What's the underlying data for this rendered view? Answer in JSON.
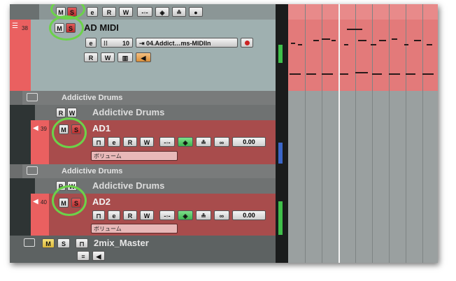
{
  "tracks": {
    "top_partial": {
      "buttons": [
        "M",
        "S",
        "e",
        "R",
        "W"
      ]
    },
    "ad_midi": {
      "number": "38",
      "name": "AD MIDI",
      "mute": "M",
      "solo": "S",
      "edit": "e",
      "channel": "10",
      "output": "04.Addict…ms-MIDIIn",
      "read": "R",
      "write": "W"
    },
    "folder1": {
      "name": "Addictive Drums"
    },
    "group1": {
      "name": "Addictive Drums",
      "read": "R",
      "write": "W"
    },
    "ad1": {
      "number": "39",
      "name": "AD1",
      "mute": "M",
      "solo": "S",
      "edit": "e",
      "read": "R",
      "write": "W",
      "link": "∞",
      "value": "0.00",
      "automation": "ボリューム"
    },
    "folder2": {
      "name": "Addictive Drums"
    },
    "group2": {
      "name": "Addictive Drums",
      "read": "R",
      "write": "W"
    },
    "ad2": {
      "number": "40",
      "name": "AD2",
      "mute": "M",
      "solo": "S",
      "edit": "e",
      "read": "R",
      "write": "W",
      "link": "∞",
      "value": "0.00",
      "automation": "ボリューム"
    },
    "master": {
      "name": "2mix_Master",
      "mute": "M",
      "solo": "S"
    }
  },
  "colors": {
    "midi_track": "#9fb0b0",
    "audio_track": "#a84c4c",
    "highlight_circle": "#6cd24a",
    "solo_active": "#c83c3c",
    "mute_active": "#e3c248",
    "midi_lane": "#e37a7a"
  },
  "icons": [
    "folder-icon",
    "speaker-icon",
    "monitor-icon",
    "record-icon",
    "lock-icon",
    "midi-icon"
  ]
}
